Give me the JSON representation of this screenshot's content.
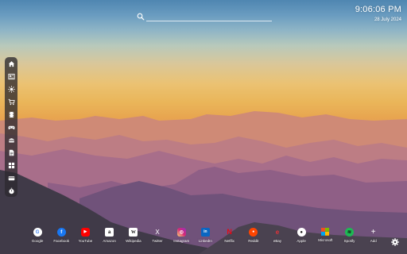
{
  "clock": {
    "time": "9:06:06 PM",
    "date": "28 July 2024"
  },
  "sidebar": {
    "items": [
      {
        "icon": "home-icon"
      },
      {
        "icon": "news-icon"
      },
      {
        "icon": "weather-icon"
      },
      {
        "icon": "cart-icon"
      },
      {
        "icon": "film-icon"
      },
      {
        "icon": "gamepad-icon"
      },
      {
        "icon": "food-icon"
      },
      {
        "icon": "document-icon"
      },
      {
        "icon": "grid-icon"
      },
      {
        "icon": "wallet-icon"
      },
      {
        "icon": "timer-icon"
      }
    ]
  },
  "dock": {
    "items": [
      {
        "label": "Google",
        "glyph": "G",
        "bg": "#ffffff",
        "fg": "#4285f4"
      },
      {
        "label": "Facebook",
        "glyph": "f",
        "bg": "#1877f2",
        "fg": "#ffffff"
      },
      {
        "label": "YouTube",
        "glyph": "▶",
        "bg": "#ff0000",
        "fg": "#ffffff"
      },
      {
        "label": "Amazon",
        "glyph": "a",
        "bg": "#ffffff",
        "fg": "#111111"
      },
      {
        "label": "Wikipedia",
        "glyph": "W",
        "bg": "#ffffff",
        "fg": "#111111"
      },
      {
        "label": "Twitter",
        "glyph": "X",
        "bg": "transparent",
        "fg": "#ffffff"
      },
      {
        "label": "Instagram",
        "glyph": "◎",
        "bg": "#d62976",
        "fg": "#ffffff"
      },
      {
        "label": "LinkedIn",
        "glyph": "in",
        "bg": "#0a66c2",
        "fg": "#ffffff"
      },
      {
        "label": "Netflix",
        "glyph": "N",
        "bg": "transparent",
        "fg": "#e50914"
      },
      {
        "label": "Reddit",
        "glyph": "●",
        "bg": "#ff4500",
        "fg": "#ffffff"
      },
      {
        "label": "eBay",
        "glyph": "e",
        "bg": "transparent",
        "fg": "#e53238"
      },
      {
        "label": "Apple",
        "glyph": "●",
        "bg": "#ffffff",
        "fg": "#111111"
      },
      {
        "label": "Microsoft",
        "glyph": "",
        "bg": "#f25022",
        "fg": "#ffffff"
      },
      {
        "label": "Spotify",
        "glyph": "≋",
        "bg": "#1db954",
        "fg": "#111111"
      },
      {
        "label": "Add",
        "glyph": "+",
        "bg": "transparent",
        "fg": "#ffffff"
      }
    ]
  }
}
